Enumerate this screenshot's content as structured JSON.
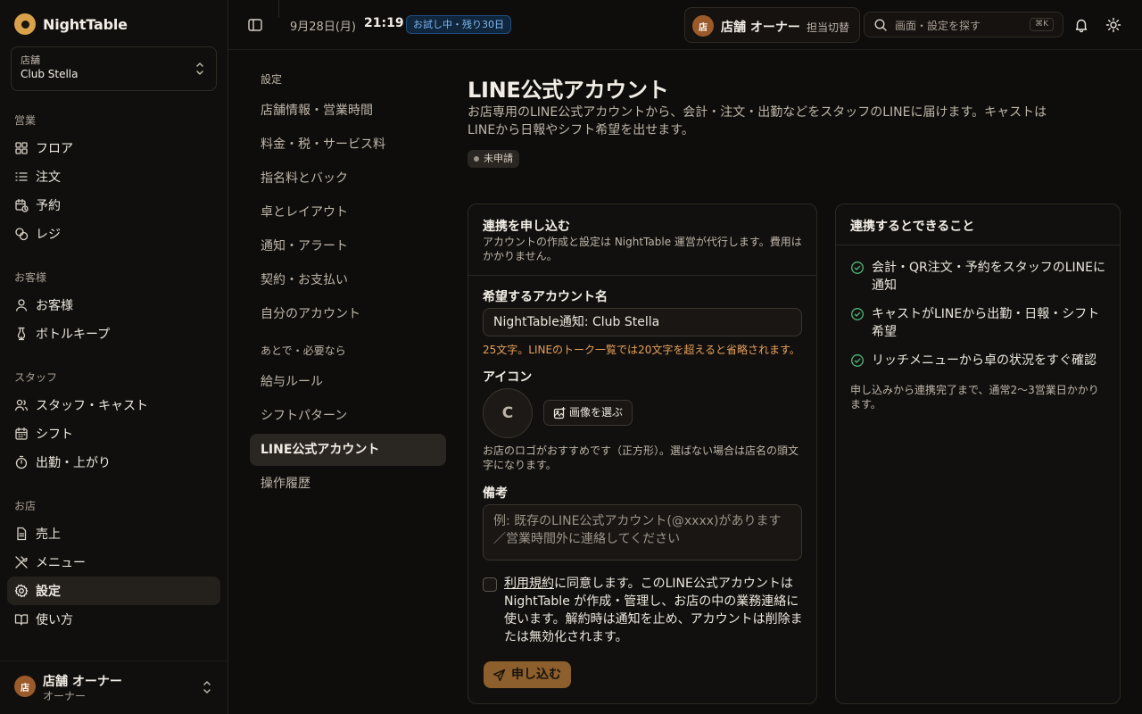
{
  "app": {
    "name": "NightTable"
  },
  "store_selector": {
    "label": "店舗",
    "value": "Club Stella"
  },
  "sidebar": {
    "groups": [
      {
        "label": "営業",
        "items": [
          {
            "label": "フロア"
          },
          {
            "label": "注文"
          },
          {
            "label": "予約"
          },
          {
            "label": "レジ"
          }
        ]
      },
      {
        "label": "お客様",
        "items": [
          {
            "label": "お客様"
          },
          {
            "label": "ボトルキープ"
          }
        ]
      },
      {
        "label": "スタッフ",
        "items": [
          {
            "label": "スタッフ・キャスト"
          },
          {
            "label": "シフト"
          },
          {
            "label": "出勤・上がり"
          }
        ]
      },
      {
        "label": "お店",
        "items": [
          {
            "label": "売上"
          },
          {
            "label": "メニュー"
          },
          {
            "label": "設定"
          },
          {
            "label": "使い方"
          }
        ]
      }
    ],
    "user": {
      "avatar": "店",
      "name": "店舗 オーナー",
      "role": "オーナー"
    }
  },
  "topbar": {
    "date": "9月28日(月)",
    "time": "21:19",
    "trial_badge": "お試し中・残り30日",
    "owner": {
      "avatar": "店",
      "name": "店舗 オーナー",
      "switch_label": "担当切替"
    },
    "search": {
      "placeholder": "画面・設定を探す",
      "shortcut": "⌘K"
    }
  },
  "settings_nav": {
    "section1_label": "設定",
    "items1": [
      {
        "label": "店舗情報・営業時間"
      },
      {
        "label": "料金・税・サービス料"
      },
      {
        "label": "指名料とバック"
      },
      {
        "label": "卓とレイアウト"
      },
      {
        "label": "通知・アラート"
      },
      {
        "label": "契約・お支払い"
      },
      {
        "label": "自分のアカウント"
      }
    ],
    "section2_label": "あとで・必要なら",
    "items2": [
      {
        "label": "給与ルール"
      },
      {
        "label": "シフトパターン"
      },
      {
        "label": "LINE公式アカウント"
      },
      {
        "label": "操作履歴"
      }
    ]
  },
  "page": {
    "title": "LINE公式アカウント",
    "description": "お店専用のLINE公式アカウントから、会計・注文・出勤などをスタッフのLINEに届けます。キャストはLINEから日報やシフト希望を出せます。",
    "status_badge": "未申請"
  },
  "apply_card": {
    "title": "連携を申し込む",
    "subtitle": "アカウントの作成と設定は NightTable 運営が代行します。費用はかかりません。",
    "account_name_label": "希望するアカウント名",
    "account_name_value": "NightTable通知: Club Stella",
    "account_name_warning": "25文字。LINEのトーク一覧では20文字を超えると省略されます。",
    "icon_label": "アイコン",
    "icon_initial": "C",
    "pick_image_label": "画像を選ぶ",
    "icon_hint": "お店のロゴがおすすめです（正方形）。選ばない場合は店名の頭文字になります。",
    "note_label": "備考",
    "note_placeholder": "例: 既存のLINE公式アカウント(@xxxx)があります／営業時間外に連絡してください",
    "terms_link": "利用規約",
    "terms_text": "に同意します。このLINE公式アカウントは NightTable が作成・管理し、お店の中の業務連絡に使います。解約時は通知を止め、アカウントは削除または無効化されます。",
    "terms_checked": false,
    "submit_label": "申し込む"
  },
  "features_card": {
    "title": "連携するとできること",
    "items": [
      {
        "text": "会計・QR注文・予約をスタッフのLINEに通知"
      },
      {
        "text": "キャストがLINEから出勤・日報・シフト希望"
      },
      {
        "text": "リッチメニューから卓の状況をすぐ確認"
      }
    ],
    "note": "申し込みから連携完了まで、通常2〜3営業日かかります。"
  },
  "colors": {
    "accent": "#d9a24a",
    "submit": "#8c5f2c",
    "warning": "#e6a05a",
    "check": "#4fb87a",
    "trial": "#7db8f2"
  }
}
